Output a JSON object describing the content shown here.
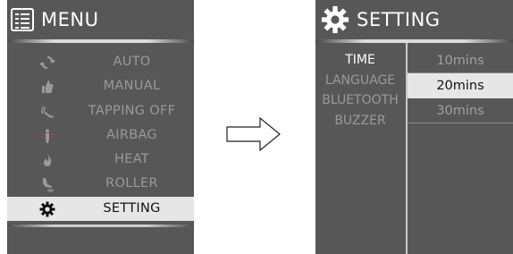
{
  "menu": {
    "title": "MENU",
    "items": [
      {
        "label": "AUTO",
        "icon": "auto-cycle-icon"
      },
      {
        "label": "MANUAL",
        "icon": "thumbs-up-icon"
      },
      {
        "label": "TAPPING OFF",
        "icon": "tapping-hand-icon"
      },
      {
        "label": "AIRBAG",
        "icon": "airbag-body-icon"
      },
      {
        "label": "HEAT",
        "icon": "flame-icon"
      },
      {
        "label": "ROLLER",
        "icon": "foot-roller-icon"
      },
      {
        "label": "SETTING",
        "icon": "gear-icon",
        "selected": true
      }
    ]
  },
  "setting": {
    "title": "SETTING",
    "categories": [
      {
        "label": "TIME",
        "active": true
      },
      {
        "label": "LANGUAGE",
        "active": false
      },
      {
        "label": "BLUETOOTH",
        "active": false
      },
      {
        "label": "BUZZER",
        "active": false
      }
    ],
    "options": [
      {
        "label": "10mins",
        "selected": false
      },
      {
        "label": "20mins",
        "selected": true
      },
      {
        "label": "30mins",
        "selected": false
      }
    ]
  },
  "colors": {
    "panel_bg": "#575757",
    "selection_bg": "#e6e6e6",
    "inactive_text": "#9a9a9a"
  }
}
